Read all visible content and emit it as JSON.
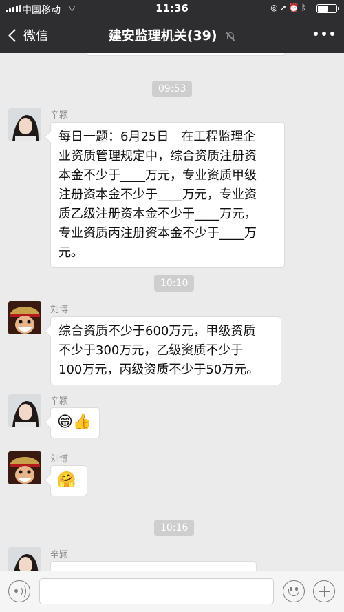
{
  "status_bar": {
    "carrier": "中国移动",
    "time": "11:36",
    "wifi_icon": "wifi-icon",
    "right_icons": [
      "lock-rotation-icon",
      "location-icon",
      "alarm-icon",
      "bluetooth-icon",
      "battery-icon"
    ]
  },
  "nav": {
    "back_label": "微信",
    "title": "建安监理机关(39)",
    "mute_icon": "mute-bell-icon",
    "more_icon": "more-icon"
  },
  "messages": [
    {
      "kind": "time",
      "text": "09:53"
    },
    {
      "kind": "msg",
      "sender": "辛颖",
      "lines": [
        "每日一题：6月25日　在工程监理企",
        "业资质管理规定中，综合资质注册资",
        "本金不少于____万元，专业资质甲级",
        "注册资本金不少于____万元，专业资",
        "质乙级注册资本金不少于____万元，",
        "专业资质丙注册资本金不少于____万",
        "元。"
      ]
    },
    {
      "kind": "time",
      "text": "10:10"
    },
    {
      "kind": "msg",
      "sender": "刘博",
      "lines": [
        "综合资质不少于600万元，甲级资质",
        "不少于300万元，乙级资质不少于",
        "100万元，丙级资质不少于50万元。"
      ]
    },
    {
      "kind": "msg",
      "sender": "辛颖",
      "emoji": "😁👍"
    },
    {
      "kind": "msg",
      "sender": "刘博",
      "emoji": "🤗"
    },
    {
      "kind": "time",
      "text": "10:16"
    },
    {
      "kind": "msg",
      "sender": "辛颖",
      "lines": []
    }
  ],
  "input_bar": {
    "voice_icon": "voice-icon",
    "emoji_icon": "emoji-icon",
    "plus_icon": "plus-icon",
    "value": ""
  },
  "colors": {
    "nav_bg": "#2e2e31",
    "chat_bg": "#ebebeb",
    "timestamp_bg": "#cecece",
    "bubble_bg": "#ffffff"
  }
}
